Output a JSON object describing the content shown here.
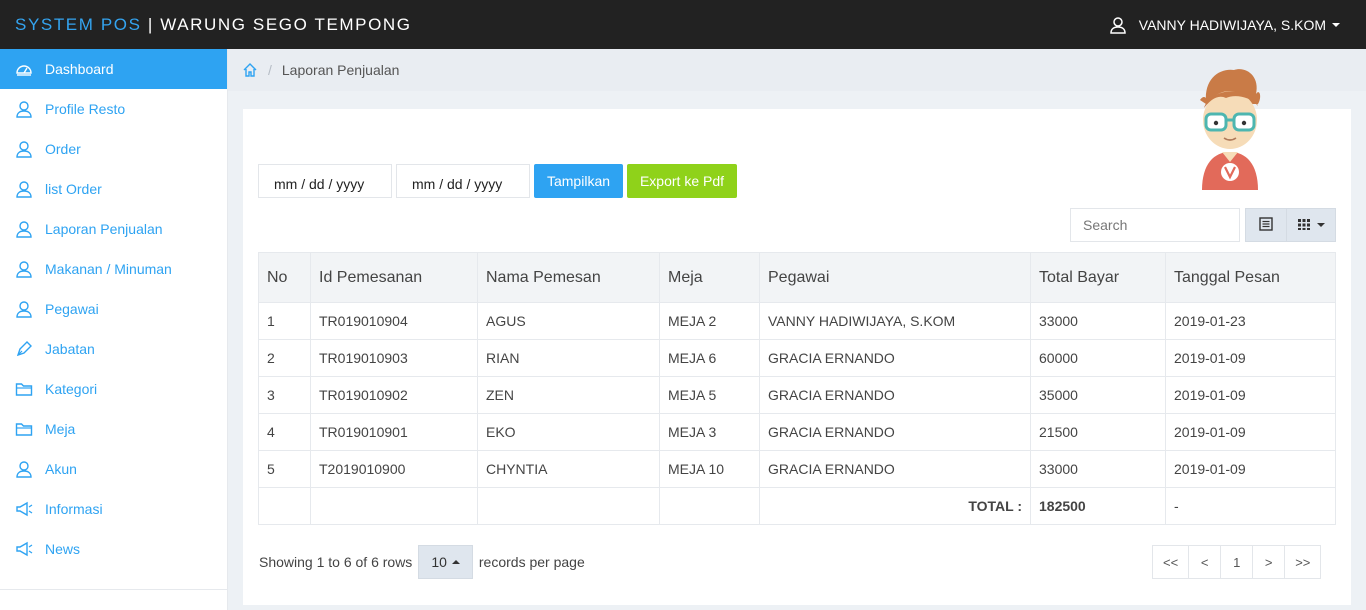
{
  "header": {
    "brand_accent": "SYSTEM POS",
    "brand_rest": " | WARUNG SEGO TEMPONG",
    "user_name": "VANNY HADIWIJAYA, S.KOM"
  },
  "sidebar": {
    "items": [
      {
        "label": "Dashboard",
        "icon": "dashboard-icon"
      },
      {
        "label": "Profile Resto",
        "icon": "user-icon"
      },
      {
        "label": "Order",
        "icon": "user-icon"
      },
      {
        "label": "list Order",
        "icon": "user-icon"
      },
      {
        "label": "Laporan Penjualan",
        "icon": "user-icon"
      },
      {
        "label": "Makanan / Minuman",
        "icon": "user-icon"
      },
      {
        "label": "Pegawai",
        "icon": "user-icon"
      },
      {
        "label": "Jabatan",
        "icon": "pen-icon"
      },
      {
        "label": "Kategori",
        "icon": "folder-icon"
      },
      {
        "label": "Meja",
        "icon": "folder-icon"
      },
      {
        "label": "Akun",
        "icon": "user-icon"
      },
      {
        "label": "Informasi",
        "icon": "megaphone-icon"
      },
      {
        "label": "News",
        "icon": "megaphone-icon"
      }
    ]
  },
  "breadcrumb": {
    "current": "Laporan Penjualan"
  },
  "filter": {
    "date_from_placeholder": "mm / dd / yyyy",
    "date_to_placeholder": "mm / dd / yyyy",
    "show_label": "Tampilkan",
    "export_label": "Export ke Pdf"
  },
  "search": {
    "placeholder": "Search"
  },
  "table": {
    "columns": [
      "No",
      "Id Pemesanan",
      "Nama Pemesan",
      "Meja",
      "Pegawai",
      "Total Bayar",
      "Tanggal Pesan"
    ],
    "rows": [
      [
        "1",
        "TR019010904",
        "AGUS",
        "MEJA 2",
        "VANNY HADIWIJAYA, S.KOM",
        "33000",
        "2019-01-23"
      ],
      [
        "2",
        "TR019010903",
        "RIAN",
        "MEJA 6",
        "GRACIA ERNANDO",
        "60000",
        "2019-01-09"
      ],
      [
        "3",
        "TR019010902",
        "ZEN",
        "MEJA 5",
        "GRACIA ERNANDO",
        "35000",
        "2019-01-09"
      ],
      [
        "4",
        "TR019010901",
        "EKO",
        "MEJA 3",
        "GRACIA ERNANDO",
        "21500",
        "2019-01-09"
      ],
      [
        "5",
        "T2019010900",
        "CHYNTIA",
        "MEJA 10",
        "GRACIA ERNANDO",
        "33000",
        "2019-01-09"
      ]
    ],
    "total_label": "TOTAL :",
    "total_value": "182500",
    "total_date": "-"
  },
  "footer": {
    "showing_text": "Showing 1 to 6 of 6 rows",
    "page_size": "10",
    "per_page_text": "records per page",
    "pages": [
      "<<",
      "<",
      "1",
      ">",
      ">>"
    ]
  },
  "colors": {
    "accent": "#2ea3f2",
    "export_green": "#8fd21a",
    "topbar": "#222222"
  }
}
